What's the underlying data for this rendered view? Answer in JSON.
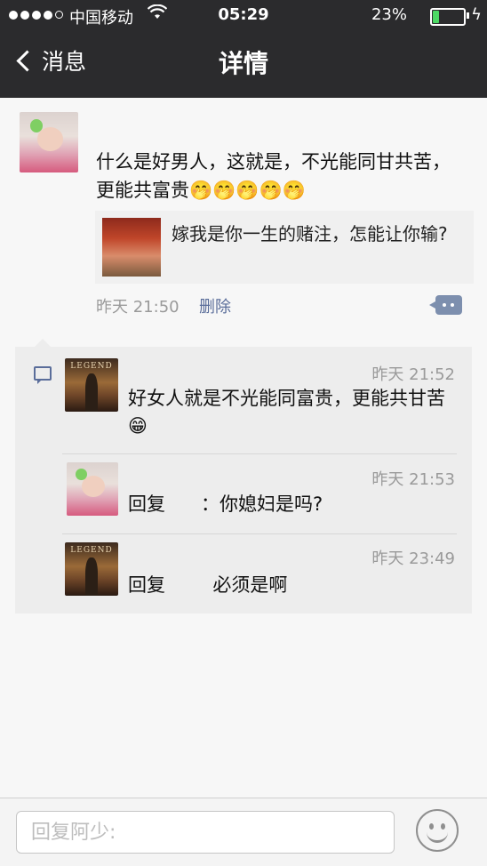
{
  "status_bar": {
    "carrier": "中国移动",
    "wifi_icon": "wifi-icon",
    "time": "05:29",
    "battery_percent": "23%",
    "battery_level": 0.23
  },
  "nav": {
    "back_label": "消息",
    "title": "详情"
  },
  "post": {
    "text": "什么是好男人，这就是，不光能同甘共苦，更能共富贵🤭🤭🤭🤭🤭",
    "link_text": "嫁我是你一生的赌注，怎能让你输?",
    "time": "昨天 21:50",
    "delete_label": "删除"
  },
  "comments": [
    {
      "time": "昨天 21:52",
      "text": "好女人就是不光能同富贵，更能共甘苦😁"
    },
    {
      "time": "昨天 21:53",
      "text": "回复      ：你媳妇是吗?"
    },
    {
      "time": "昨天 23:49",
      "text": "回复        必须是啊"
    }
  ],
  "input": {
    "placeholder": "回复阿少:"
  },
  "colors": {
    "nav_bg": "#2b2b2d",
    "link_blue": "#5a6d9a",
    "comment_bg": "#ededed",
    "battery_green": "#4cd964"
  }
}
